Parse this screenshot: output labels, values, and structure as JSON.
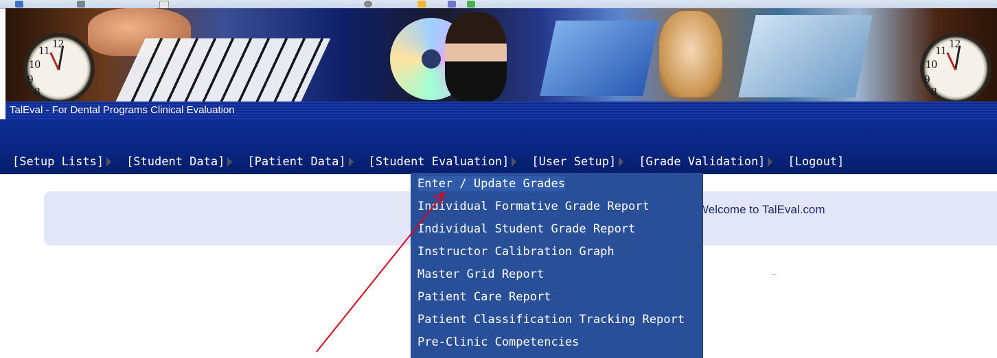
{
  "app": {
    "title": "TalEval - For Dental Programs Clinical Evaluation"
  },
  "banner": {
    "clock_left": {
      "n11": "11",
      "n12": "12",
      "n10": "10",
      "n9": "9",
      "n8": "8"
    },
    "clock_right": {
      "n11": "11",
      "n12": "12",
      "n10": "10",
      "n9": "9",
      "n8": "8"
    }
  },
  "nav": {
    "items": [
      {
        "label": "[Setup Lists]"
      },
      {
        "label": "[Student Data]"
      },
      {
        "label": "[Patient Data]"
      },
      {
        "label": "[Student Evaluation]"
      },
      {
        "label": "[User Setup]"
      },
      {
        "label": "[Grade Validation]"
      },
      {
        "label": "[Logout]"
      }
    ]
  },
  "dropdown": {
    "items": [
      {
        "label": "Enter / Update Grades"
      },
      {
        "label": "Individual Formative Grade Report"
      },
      {
        "label": "Individual Student Grade Report"
      },
      {
        "label": "Instructor Calibration Graph"
      },
      {
        "label": "Master Grid Report"
      },
      {
        "label": "Patient Care Report"
      },
      {
        "label": "Patient Classification Tracking Report"
      },
      {
        "label": "Pre-Clinic Competencies"
      }
    ]
  },
  "main": {
    "welcome_text": "Welcome to TalEval.com",
    "dots": ".."
  },
  "colors": {
    "nav_bg": "#0a2682",
    "dropdown_bg": "#284f97",
    "annotation_arrow": "#e0001b"
  }
}
